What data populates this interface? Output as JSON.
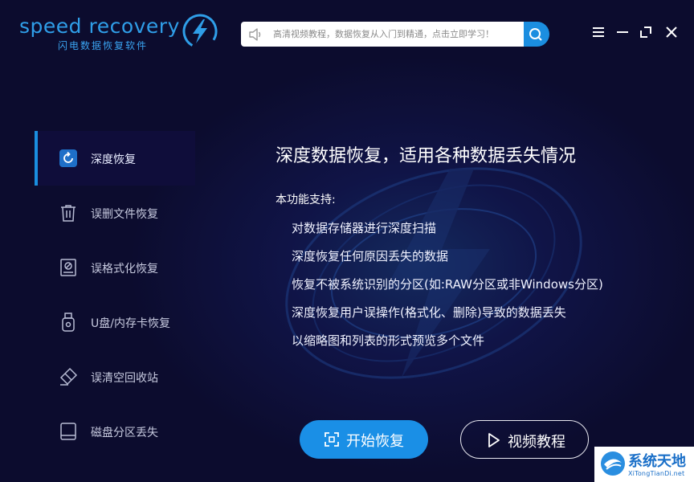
{
  "app": {
    "logo_name": "speed recovery",
    "logo_subtitle": "闪电数据恢复软件"
  },
  "search": {
    "placeholder": "高清视频教程，数据恢复从入门到精通，点击立即学习！",
    "button_label": "Q"
  },
  "window_controls": [
    "menu",
    "minimize",
    "maximize",
    "close"
  ],
  "sidebar": {
    "items": [
      {
        "label": "深度恢复",
        "icon": "refresh-icon",
        "active": true
      },
      {
        "label": "误删文件恢复",
        "icon": "trash-icon",
        "active": false
      },
      {
        "label": "误格式化恢复",
        "icon": "format-disk-icon",
        "active": false
      },
      {
        "label": "U盘/内存卡恢复",
        "icon": "usb-drive-icon",
        "active": false
      },
      {
        "label": "误清空回收站",
        "icon": "eraser-icon",
        "active": false
      },
      {
        "label": "磁盘分区丢失",
        "icon": "hard-disk-icon",
        "active": false
      }
    ]
  },
  "main": {
    "title": "深度数据恢复，适用各种数据丢失情况",
    "support_label": "本功能支持:",
    "features": [
      "对数据存储器进行深度扫描",
      "深度恢复任何原因丢失的数据",
      "恢复不被系统识别的分区(如:RAW分区或非Windows分区)",
      "深度恢复用户误操作(格式化、删除)导致的数据丢失",
      "以缩略图和列表的形式预览多个文件"
    ],
    "start_button": "开始恢复",
    "video_button": "视频教程"
  },
  "watermark": {
    "text": "系统天地",
    "url": "XiTongTianDi.net"
  },
  "colors": {
    "background": "#0c0c2e",
    "accent": "#1a8fe6",
    "active_item_bg": "#0f0d3a"
  }
}
